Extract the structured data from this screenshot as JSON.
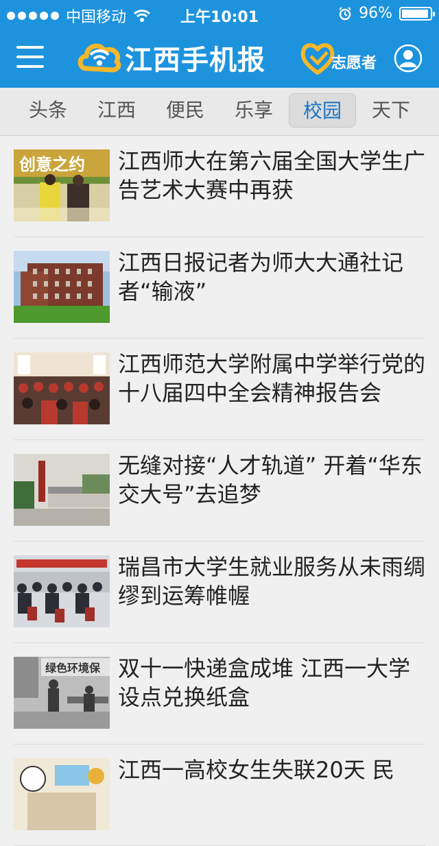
{
  "status_bar": {
    "carrier": "中国移动",
    "time": "上午10:01",
    "battery": "96%",
    "battery_level": 0.96
  },
  "header": {
    "app_title": "江西手机报",
    "volunteer_label": "志愿者"
  },
  "tabs": [
    {
      "label": "头条",
      "active": false
    },
    {
      "label": "江西",
      "active": false
    },
    {
      "label": "便民",
      "active": false
    },
    {
      "label": "乐享",
      "active": false
    },
    {
      "label": "校园",
      "active": true
    },
    {
      "label": "天下",
      "active": false
    }
  ],
  "news": [
    {
      "title": "江西师大在第六届全国大学生广告艺术大赛中再获",
      "thumb_text": "创意之约"
    },
    {
      "title": "江西日报记者为师大大通社记者“输液”"
    },
    {
      "title": "江西师范大学附属中学举行党的十八届四中全会精神报告会"
    },
    {
      "title": "无缝对接“人才轨道” 开着“华东交大号”去追梦"
    },
    {
      "title": "瑞昌市大学生就业服务从未雨绸缪到运筹帷幄"
    },
    {
      "title": "双十一快递盒成堆 江西一大学设点兑换纸盒",
      "thumb_text": "绿色环境保"
    },
    {
      "title": "江西一高校女生失联20天 民"
    }
  ],
  "colors": {
    "header_bg": "#1d93de",
    "active_tab_text": "#1a74c2",
    "logo_yellow": "#f5b72b"
  }
}
